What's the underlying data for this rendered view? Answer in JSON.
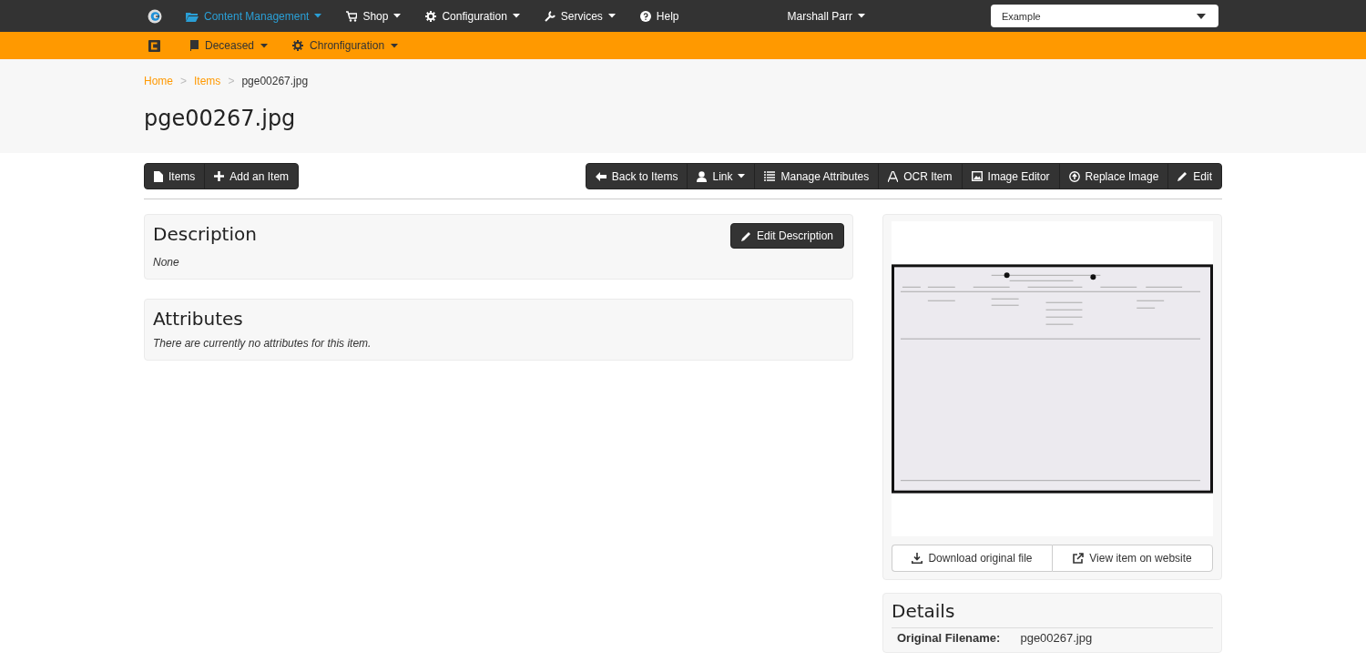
{
  "top_nav": {
    "items": [
      {
        "label": "Content Management",
        "selected": true,
        "dropdown": true
      },
      {
        "label": "Shop",
        "selected": false,
        "dropdown": true
      },
      {
        "label": "Configuration",
        "selected": false,
        "dropdown": true
      },
      {
        "label": "Services",
        "selected": false,
        "dropdown": true
      },
      {
        "label": "Help",
        "selected": false,
        "dropdown": false
      }
    ],
    "user": "Marshall Parr",
    "site_select": {
      "value": "Example"
    }
  },
  "sub_nav": {
    "items": [
      {
        "label": "Deceased"
      },
      {
        "label": "Chronfiguration"
      }
    ]
  },
  "breadcrumb": [
    {
      "label": "Home",
      "link": true
    },
    {
      "label": "Items",
      "link": true
    },
    {
      "label": "pge00267.jpg",
      "link": false
    }
  ],
  "breadcrumb_separator": ">",
  "page_title": "pge00267.jpg",
  "left_toolbar": [
    "Items",
    "Add an Item"
  ],
  "right_toolbar": [
    {
      "label": "Back to Items",
      "dropdown": false
    },
    {
      "label": "Link",
      "dropdown": true
    },
    {
      "label": "Manage Attributes",
      "dropdown": false
    },
    {
      "label": "OCR Item",
      "dropdown": false
    },
    {
      "label": "Image Editor",
      "dropdown": false
    },
    {
      "label": "Replace Image",
      "dropdown": false
    },
    {
      "label": "Edit",
      "dropdown": false
    }
  ],
  "description": {
    "title": "Description",
    "button": "Edit Description",
    "text": "None"
  },
  "attributes": {
    "title": "Attributes",
    "text": "There are currently no attributes for this item."
  },
  "preview": {
    "buttons": [
      "Download original file",
      "View item on website"
    ]
  },
  "details": {
    "title": "Details",
    "rows": [
      {
        "label": "Original Filename:",
        "value": "pge00267.jpg"
      }
    ]
  }
}
